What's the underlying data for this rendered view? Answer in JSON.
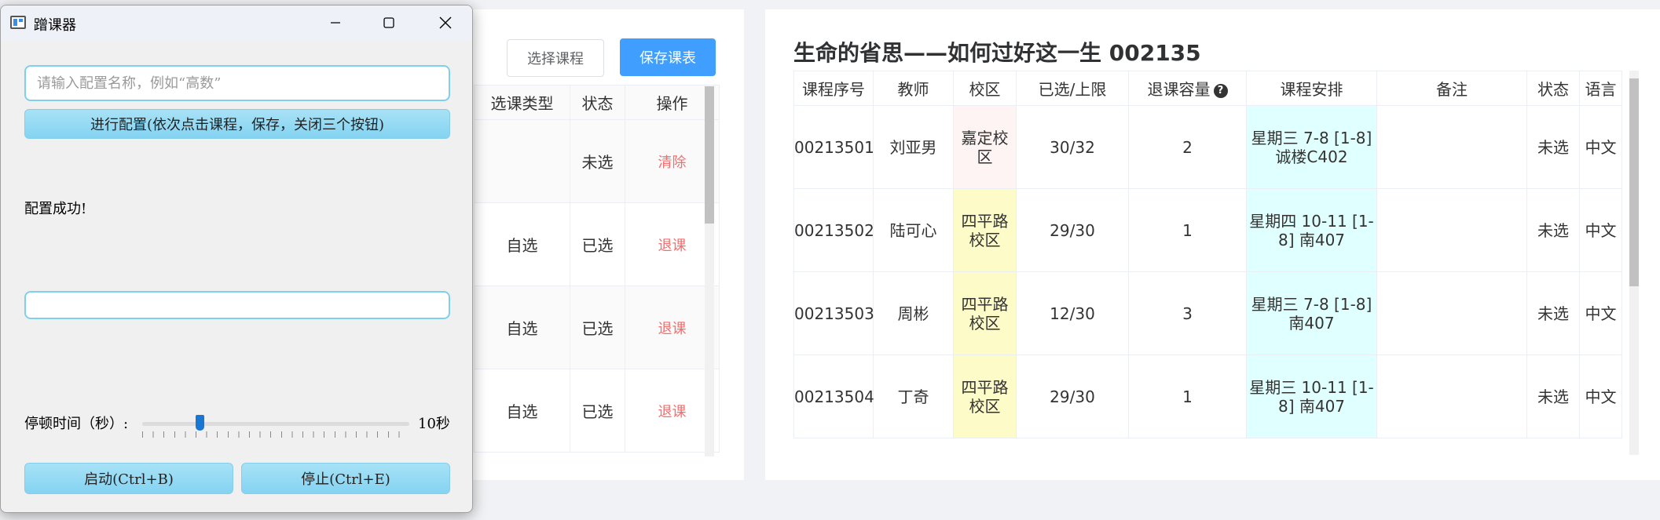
{
  "left_panel": {
    "select_button": "选择课程",
    "save_button": "保存课表",
    "headers": [
      "选课类型",
      "状态",
      "操作"
    ],
    "rows": [
      {
        "type": "",
        "status": "未选",
        "action": "清除"
      },
      {
        "type": "自选",
        "status": "已选",
        "action": "退课"
      },
      {
        "type": "自选",
        "status": "已选",
        "action": "退课"
      },
      {
        "type": "自选",
        "status": "已选",
        "action": "退课"
      }
    ]
  },
  "right_panel": {
    "title": "生命的省思——如何过好这一生 002135",
    "headers": {
      "seq": "课程序号",
      "teacher": "教师",
      "campus": "校区",
      "selected": "已选/上限",
      "drop_capacity": "退课容量",
      "help_icon": "?",
      "schedule": "课程安排",
      "note": "备注",
      "status": "状态",
      "language": "语言"
    },
    "rows": [
      {
        "seq": "00213501",
        "teacher": "刘亚男",
        "campus": "嘉定校区",
        "selected": "30/32",
        "drop_capacity": "2",
        "schedule": "星期三 7-8 [1-8] 诚楼C402",
        "note": "",
        "status": "未选",
        "language": "中文"
      },
      {
        "seq": "00213502",
        "teacher": "陆可心",
        "campus": "四平路校区",
        "selected": "29/30",
        "drop_capacity": "1",
        "schedule": "星期四 10-11 [1-8] 南407",
        "note": "",
        "status": "未选",
        "language": "中文"
      },
      {
        "seq": "00213503",
        "teacher": "周彬",
        "campus": "四平路校区",
        "selected": "12/30",
        "drop_capacity": "3",
        "schedule": "星期三 7-8 [1-8] 南407",
        "note": "",
        "status": "未选",
        "language": "中文"
      },
      {
        "seq": "00213504",
        "teacher": "丁奇",
        "campus": "四平路校区",
        "selected": "29/30",
        "drop_capacity": "1",
        "schedule": "星期三 10-11 [1-8] 南407",
        "note": "",
        "status": "未选",
        "language": "中文"
      }
    ]
  },
  "window": {
    "title": "蹭课器",
    "config_input": {
      "value": "",
      "placeholder": "请输入配置名称，例如“高数”"
    },
    "config_button": "进行配置(依次点击课程，保存，关闭三个按钮)",
    "success_message": "配置成功!",
    "empty_input": {
      "value": ""
    },
    "pause_label": "停顿时间（秒）:",
    "pause_value": "10秒",
    "slider_level": 0.2,
    "start_button": "启动(Ctrl+B)",
    "stop_button": "停止(Ctrl+E)"
  },
  "colors": {
    "primary": "#409eff",
    "success": "#67c23a",
    "danger": "#f56c6c",
    "campus_jiading": "#fef4f4",
    "campus_siping": "#fdfbc7",
    "schedule_bg": "#e0ffff"
  }
}
